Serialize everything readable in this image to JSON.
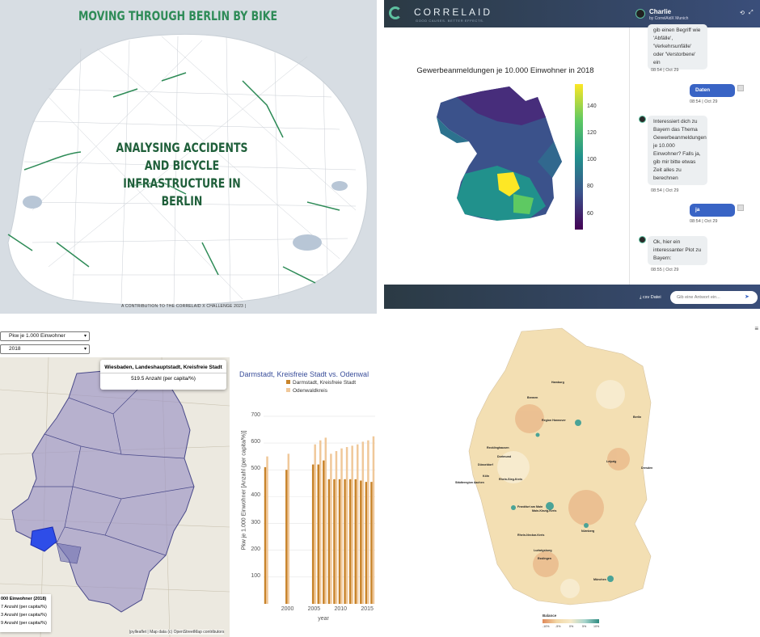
{
  "berlin": {
    "title": "MOVING THROUGH BERLIN BY BIKE",
    "subtitle_line1": "ANALYSING ACCIDENTS AND BICYCLE",
    "subtitle_line2": "INFRASTRUCTURE IN BERLIN",
    "credit": "A CONTRIBUTION TO THE CORRELAID X CHALLENGE 2023 |"
  },
  "chat": {
    "brand": "CORRELAID",
    "tagline": "GOOD CAUSES. BETTER EFFECTS.",
    "user_name": "Charlie",
    "user_sub": "by CorrelAidX Munich",
    "chart_title": "Gewerbeanmeldungen je 10.000 Einwohner in 2018",
    "colorbar_ticks": [
      "140",
      "120",
      "100",
      "80",
      "60"
    ],
    "messages": [
      {
        "from": "bot",
        "text": "gib einen Begriff wie 'Abfälle', 'Verkehrsunfälle' oder 'Verstorbene' ein",
        "time": "08:54 | Oct 29"
      },
      {
        "from": "user",
        "text": "Daten",
        "time": "08:54 | Oct 29"
      },
      {
        "from": "bot",
        "text": "Interessiert dich zu Bayern das Thema Gewerbeanmeldungen je 10.000 Einwohner? Falls ja, gib mir bitte etwas Zeit alles zu berechnen",
        "time": "08:54 | Oct 29"
      },
      {
        "from": "user",
        "text": "ja",
        "time": "08:54 | Oct 29"
      },
      {
        "from": "bot",
        "text": "Ok, hier ein interessanter Plot zu Bayern:",
        "time": "08:55 | Oct 29"
      }
    ],
    "csv_label": "csv Datei",
    "input_placeholder": "Gib eine Antwort ein..."
  },
  "hesse": {
    "select1_label": "s:",
    "select1_value": "Pkw je 1.000 Einwohner",
    "select2_label": "r:",
    "select2_value": "2018",
    "popup_title": "Wiesbaden, Landeshauptstadt, Kreisfreie Stadt",
    "popup_value": "519.5 Anzahl (per capita/%)",
    "legend_title": "000 Einwohner (2018)",
    "legend_rows": [
      "7 Anzahl (per capita/%)",
      "3 Anzahl (per capita/%)",
      "9 Anzahl (per capita/%)"
    ],
    "attribution": "|pylleaflet | Map data (c) OpenStreetMap contributors",
    "bar_title": "Darmstadt, Kreisfreie Stadt vs. Odenwal",
    "legend_a": "Darmstadt, Kreisfreie Stadt",
    "legend_b": "Odenwaldkreis",
    "ylabel": "Pkw je 1.000 Einwohner [Anzahl (per capita/%)]",
    "xlabel": "year",
    "colors": {
      "a": "#c8842b",
      "b": "#f0c89a"
    }
  },
  "chart_data": {
    "type": "bar",
    "title": "Darmstadt, Kreisfreie Stadt vs. Odenwal",
    "xlabel": "year",
    "ylabel": "Pkw je 1.000 Einwohner [Anzahl (per capita/%)]",
    "ylim": [
      0,
      760
    ],
    "xlim": [
      1995.5,
      2016.5
    ],
    "y_ticks": [
      100,
      200,
      300,
      400,
      500,
      600,
      700
    ],
    "x_ticks": [
      2000,
      2005,
      2010,
      2015
    ],
    "x": [
      1996,
      2000,
      2005,
      2006,
      2007,
      2008,
      2009,
      2010,
      2011,
      2012,
      2013,
      2014,
      2015,
      2016
    ],
    "series": [
      {
        "name": "Darmstadt, Kreisfreie Stadt",
        "values": [
          510,
          500,
          520,
          520,
          535,
          465,
          465,
          465,
          465,
          465,
          465,
          460,
          455,
          455
        ]
      },
      {
        "name": "Odenwaldkreis",
        "values": [
          550,
          560,
          595,
          610,
          620,
          560,
          570,
          580,
          585,
          590,
          595,
          605,
          610,
          625
        ]
      }
    ]
  },
  "germany": {
    "cities": [
      "Hamburg",
      "Bremen",
      "Region Hannover",
      "Berlin",
      "Recklinghausen",
      "Dortmund",
      "Düsseldorf",
      "Leipzig",
      "Dresden",
      "Köln",
      "Rhein-Sieg-Kreis",
      "Städteregion Aachen",
      "Frankfurt am Main",
      "Main-Kinzig-Kreis",
      "Rhein-Neckar-Kreis",
      "Nürnberg",
      "Ludwigsburg",
      "Esslingen",
      "München"
    ],
    "legend_title": "Balance",
    "legend_ticks": [
      "-10%",
      "-5%",
      "0%",
      "5%",
      "10%"
    ]
  }
}
